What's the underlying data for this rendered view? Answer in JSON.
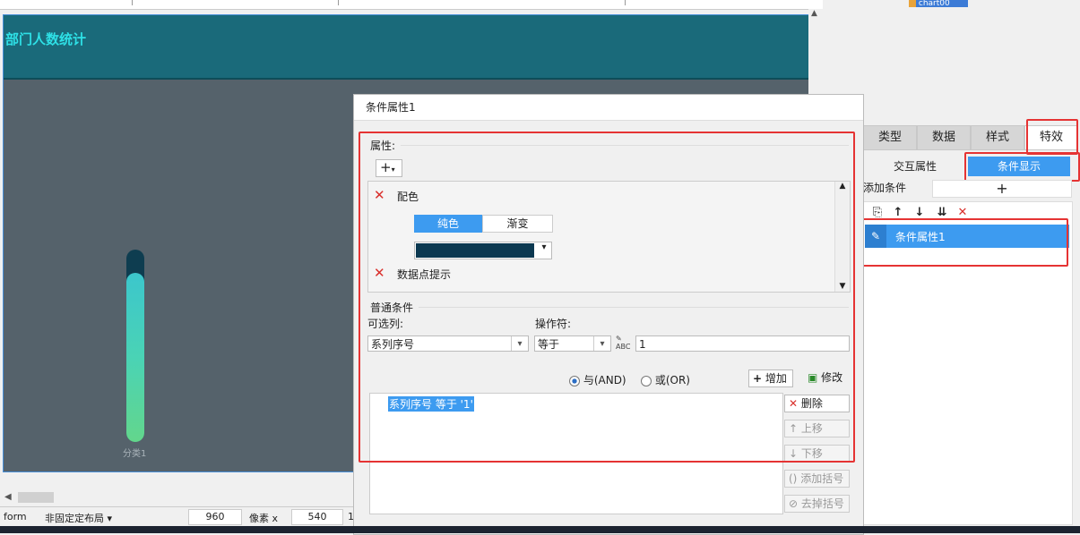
{
  "canvas": {
    "title": "部门人数统计",
    "category_label": "分类1"
  },
  "status_bar": {
    "layout_type_label": "form",
    "layout_mode": "非固定定布局",
    "width_value": "960",
    "unit_label": "像素 x",
    "height_value": "540",
    "extra": "1"
  },
  "right_panel": {
    "chart_chip": "chart00",
    "tabs": [
      "类型",
      "数据",
      "样式",
      "特效"
    ],
    "subtabs": [
      "交互属性",
      "条件显示"
    ],
    "add_condition_label": "添加条件",
    "add_symbol": "+",
    "condition_item": "条件属性1"
  },
  "dialog": {
    "title": "条件属性1",
    "attributes_label": "属性:",
    "add_attr_symbol": "+",
    "color_label": "配色",
    "solid_label": "纯色",
    "gradient_label": "渐变",
    "selected_color": "#0b3850",
    "tooltip_label": "数据点提示",
    "normal_condition_label": "普通条件",
    "column_label": "可选列:",
    "column_value": "系列序号",
    "operator_label": "操作符:",
    "operator_value": "等于",
    "value_input": "1",
    "and_label": "与(AND)",
    "or_label": "或(OR)",
    "add_button": "增加",
    "modify_button": "修改",
    "delete_button": "删除",
    "up_button": "上移",
    "down_button": "下移",
    "add_bracket_button": "添加括号",
    "remove_bracket_button": "去掉括号",
    "condition_expression": "系列序号 等于 '1'"
  }
}
